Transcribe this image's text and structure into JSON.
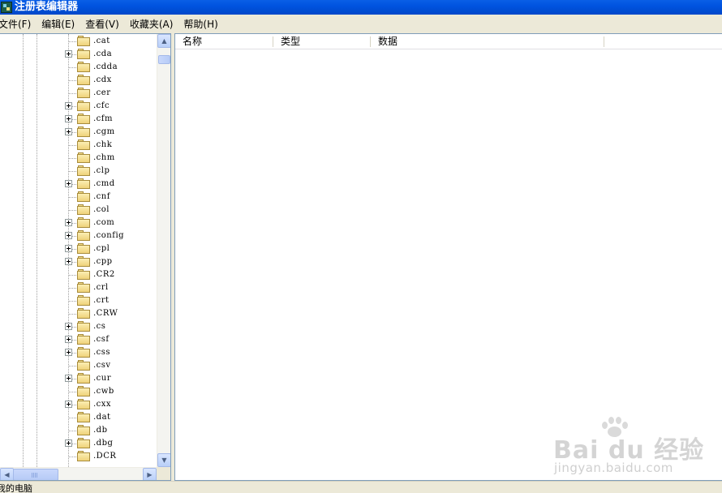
{
  "window": {
    "title": "注册表编辑器",
    "app_icon": "registry-editor-icon"
  },
  "menu": [
    {
      "label": "文件(F)"
    },
    {
      "label": "编辑(E)"
    },
    {
      "label": "查看(V)"
    },
    {
      "label": "收藏夹(A)"
    },
    {
      "label": "帮助(H)"
    }
  ],
  "tree": {
    "items": [
      {
        "label": ".cat",
        "expandable": false
      },
      {
        "label": ".cda",
        "expandable": true
      },
      {
        "label": ".cdda",
        "expandable": false
      },
      {
        "label": ".cdx",
        "expandable": false
      },
      {
        "label": ".cer",
        "expandable": false
      },
      {
        "label": ".cfc",
        "expandable": true
      },
      {
        "label": ".cfm",
        "expandable": true
      },
      {
        "label": ".cgm",
        "expandable": true
      },
      {
        "label": ".chk",
        "expandable": false
      },
      {
        "label": ".chm",
        "expandable": false
      },
      {
        "label": ".clp",
        "expandable": false
      },
      {
        "label": ".cmd",
        "expandable": true
      },
      {
        "label": ".cnf",
        "expandable": false
      },
      {
        "label": ".col",
        "expandable": false
      },
      {
        "label": ".com",
        "expandable": true
      },
      {
        "label": ".config",
        "expandable": true
      },
      {
        "label": ".cpl",
        "expandable": true
      },
      {
        "label": ".cpp",
        "expandable": true
      },
      {
        "label": ".CR2",
        "expandable": false
      },
      {
        "label": ".crl",
        "expandable": false
      },
      {
        "label": ".crt",
        "expandable": false
      },
      {
        "label": ".CRW",
        "expandable": false
      },
      {
        "label": ".cs",
        "expandable": true
      },
      {
        "label": ".csf",
        "expandable": true
      },
      {
        "label": ".css",
        "expandable": true
      },
      {
        "label": ".csv",
        "expandable": false
      },
      {
        "label": ".cur",
        "expandable": true
      },
      {
        "label": ".cwb",
        "expandable": false
      },
      {
        "label": ".cxx",
        "expandable": true
      },
      {
        "label": ".dat",
        "expandable": false
      },
      {
        "label": ".db",
        "expandable": false
      },
      {
        "label": ".dbg",
        "expandable": true
      },
      {
        "label": ".DCR",
        "expandable": false
      }
    ]
  },
  "list": {
    "columns": [
      {
        "label": "名称"
      },
      {
        "label": "类型"
      },
      {
        "label": "数据"
      }
    ]
  },
  "watermark": {
    "brand": "Bai du 经验",
    "url": "jingyan.baidu.com"
  },
  "status": {
    "text": "我的电脑"
  },
  "colors": {
    "titlebar": "#0053e0",
    "chrome": "#ece9d8",
    "folder": "#efd27a"
  }
}
